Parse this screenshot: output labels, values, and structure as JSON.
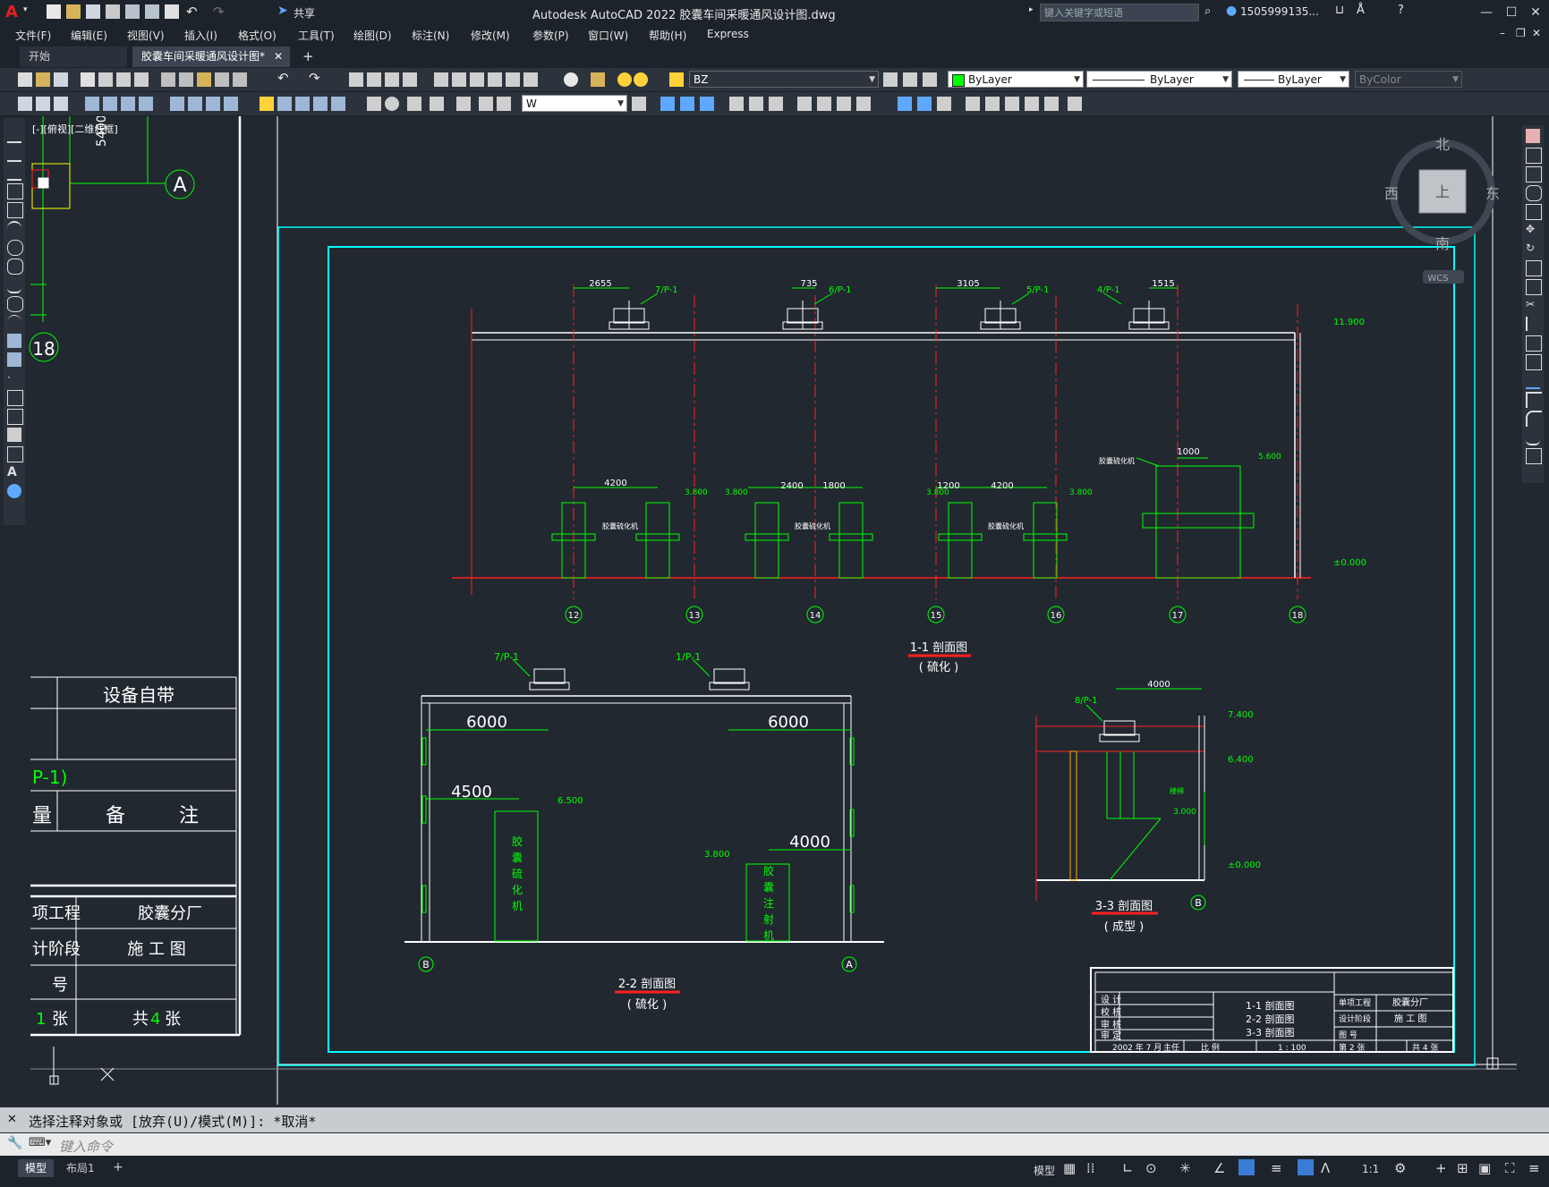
{
  "app": {
    "title": "Autodesk AutoCAD 2022    胶囊车间采暖通风设计图.dwg",
    "share_label": "共享",
    "search_placeholder": "键入关键字或短语",
    "user": "1505999135..."
  },
  "menu": [
    "文件(F)",
    "编辑(E)",
    "视图(V)",
    "插入(I)",
    "格式(O)",
    "工具(T)",
    "绘图(D)",
    "标注(N)",
    "修改(M)",
    "参数(P)",
    "窗口(W)",
    "帮助(H)",
    "Express"
  ],
  "tabs": {
    "start": "开始",
    "drawing": "胶囊车间采暖通风设计图*"
  },
  "toolbar": {
    "layer": "BZ",
    "color": "ByLayer",
    "linetype": "ByLayer",
    "lineweight": "ByLayer",
    "plotstyle": "ByColor",
    "textstyle": "W"
  },
  "viewport": {
    "label": "[-][俯视][二维线框]",
    "compass": {
      "n": "北",
      "s": "南",
      "w": "西",
      "e": "东",
      "top": "上",
      "ucs": "WCS"
    }
  },
  "drawing": {
    "left_legend": {
      "dim": "5400",
      "axis_a": "A",
      "axis_18": "18",
      "cells": [
        "设备自带",
        "P-1)",
        "量",
        "备",
        "注",
        "项工程",
        "胶囊分厂",
        "计阶段",
        "施 工 图",
        "号",
        "1",
        "张",
        "共",
        "4",
        "张"
      ]
    },
    "section11": {
      "title": "1-1 剖面图",
      "subtitle": "( 硫化 )",
      "fan_tags": [
        "7/P-1",
        "6/P-1",
        "5/P-1",
        "4/P-1"
      ],
      "fan_dims": [
        "2655",
        "735",
        "3105",
        "1515"
      ],
      "elev_top": "11.900",
      "elev_zero": "±0.000",
      "machine_label": "胶囊硫化机",
      "dims": [
        "4200",
        "2400",
        "1800",
        "1200",
        "4200",
        "1000"
      ],
      "elevs": [
        "3.800",
        "3.800",
        "3.800",
        "3.800",
        "5.600"
      ],
      "axes": [
        "12",
        "13",
        "14",
        "15",
        "16",
        "17",
        "18"
      ]
    },
    "section22": {
      "title": "2-2 剖面图",
      "subtitle": "( 硫化 )",
      "fan_tags": [
        "7/P-1",
        "1/P-1"
      ],
      "dims": [
        "6000",
        "6000",
        "4500",
        "4000"
      ],
      "elevs": [
        "6.500",
        "3.800"
      ],
      "machine1": "胶囊硫化机",
      "machine2": "胶囊注射机",
      "axes": [
        "B",
        "A"
      ]
    },
    "section33": {
      "title": "3-3 剖面图",
      "subtitle": "( 成型 )",
      "fan_tag": "8/P-1",
      "dim": "4000",
      "elevs": [
        "7.400",
        "6.400",
        "3.000",
        "±0.000"
      ],
      "note": "楼梯",
      "axis": "B"
    },
    "title_block": {
      "roles": [
        "设 计",
        "校 核",
        "审 核",
        "审 定"
      ],
      "sheets": [
        "1-1 剖面图",
        "2-2 剖面图",
        "3-3 剖面图"
      ],
      "date": "2002 年 7 月",
      "unit_label": "主任",
      "scale_label": "比 例",
      "scale": "1 : 100",
      "proj_label": "单项工程",
      "proj": "胶囊分厂",
      "stage_label": "设计阶段",
      "stage": "施 工 图",
      "no_label": "图 号",
      "sheet_no": "第 2 张",
      "sheet_total": "共 4 张"
    }
  },
  "command": {
    "history": "选择注释对象或 [放弃(U)/模式(M)]: *取消*",
    "placeholder": "键入命令"
  },
  "status": {
    "model": "模型",
    "layout": "布局1",
    "scale": "1:1"
  },
  "colors": {
    "bg": "#212830",
    "green": "#00ff00",
    "red": "#ff2020",
    "cyan": "#00ffff",
    "white": "#ffffff"
  }
}
